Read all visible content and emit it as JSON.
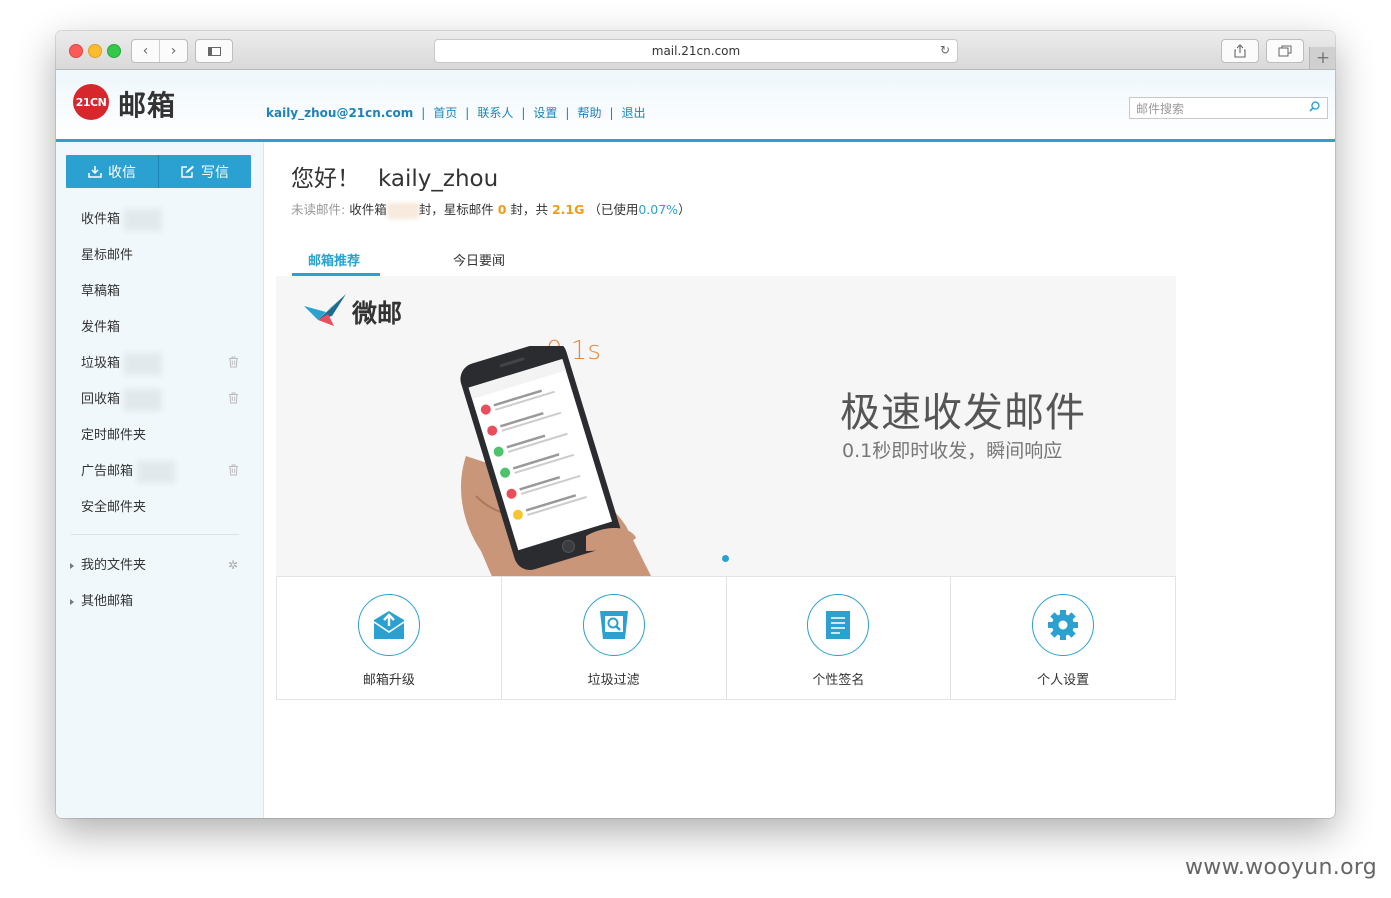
{
  "browser": {
    "url": "mail.21cn.com"
  },
  "header": {
    "logo_mark": "21CN",
    "logo_text": "邮箱",
    "user_email": "kaily_zhou@21cn.com",
    "nav": [
      "首页",
      "联系人",
      "设置",
      "帮助",
      "退出"
    ],
    "search_placeholder": "邮件搜索"
  },
  "sidebar": {
    "receive_label": "收信",
    "compose_label": "写信",
    "folders": [
      "收件箱",
      "星标邮件",
      "草稿箱",
      "发件箱",
      "垃圾箱",
      "回收箱",
      "定时邮件夹",
      "广告邮箱",
      "安全邮件夹"
    ],
    "my_folders": "我的文件夹",
    "other_mailboxes": "其他邮箱"
  },
  "main": {
    "greeting": "您好！",
    "username": "kaily_zhou",
    "unread_label": "未读邮件:",
    "inbox_label": "收件箱",
    "unit1": "封，",
    "starred_label": "星标邮件",
    "starred_count": "0",
    "unit2": "封，",
    "total_label": "共",
    "total_size": "2.1G",
    "used_open": "（已使用",
    "used_pct": "0.07%",
    "used_close": "）",
    "tabs": [
      "邮箱推荐",
      "今日要闻"
    ]
  },
  "banner": {
    "brand": "微邮",
    "speed": "0.1s",
    "title": "极速收发邮件",
    "subtitle": "0.1秒即时收发，瞬间响应"
  },
  "tiles": [
    {
      "label": "邮箱升级",
      "icon": "envelope-upgrade-icon"
    },
    {
      "label": "垃圾过滤",
      "icon": "spam-filter-icon"
    },
    {
      "label": "个性签名",
      "icon": "signature-icon"
    },
    {
      "label": "个人设置",
      "icon": "gear-icon"
    }
  ],
  "watermark": "www.wooyun.org",
  "colors": {
    "accent": "#2aa1d1",
    "orange": "#f39a1a",
    "logo_red": "#d8262d"
  }
}
